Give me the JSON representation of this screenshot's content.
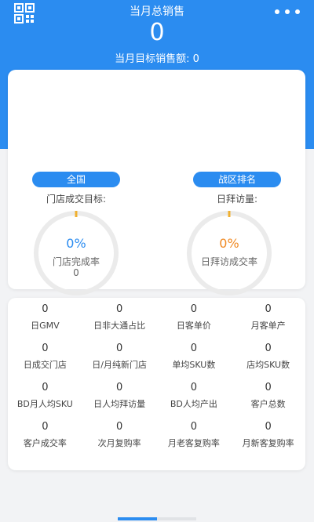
{
  "header": {
    "title": "当月总销售",
    "value": "0",
    "target_label": "当月目标销售额: 0"
  },
  "summary": {
    "left": {
      "tab": "全国",
      "label": "门店成交目标:",
      "percent_text": "0%",
      "percent_value": 0,
      "sub_label": "门店完成率",
      "sub_value": "0"
    },
    "right": {
      "tab": "战区排名",
      "label": "日拜访量:",
      "percent_text": "0%",
      "percent_value": 0,
      "sub_label": "日拜访成交率"
    }
  },
  "stats": [
    {
      "value": "0",
      "label": "日GMV"
    },
    {
      "value": "0",
      "label": "日非大通占比"
    },
    {
      "value": "0",
      "label": "日客单价"
    },
    {
      "value": "0",
      "label": "月客单产"
    },
    {
      "value": "0",
      "label": "日成交门店"
    },
    {
      "value": "0",
      "label": "日/月纯新门店"
    },
    {
      "value": "0",
      "label": "单均SKU数"
    },
    {
      "value": "0",
      "label": "店均SKU数"
    },
    {
      "value": "0",
      "label": "BD月人均SKU"
    },
    {
      "value": "0",
      "label": "日人均拜访量"
    },
    {
      "value": "0",
      "label": "BD人均产出"
    },
    {
      "value": "0",
      "label": "客户总数"
    },
    {
      "value": "0",
      "label": "客户成交率"
    },
    {
      "value": "0",
      "label": "次月复购率"
    },
    {
      "value": "0",
      "label": "月老客复购率"
    },
    {
      "value": "0",
      "label": "月新客复购率"
    }
  ],
  "icons": {
    "qr": "qr-code-icon",
    "more": "more-options-icon"
  },
  "colors": {
    "primary": "#2b8cf0",
    "accent": "#f08a24",
    "ring": "#ebebeb"
  }
}
